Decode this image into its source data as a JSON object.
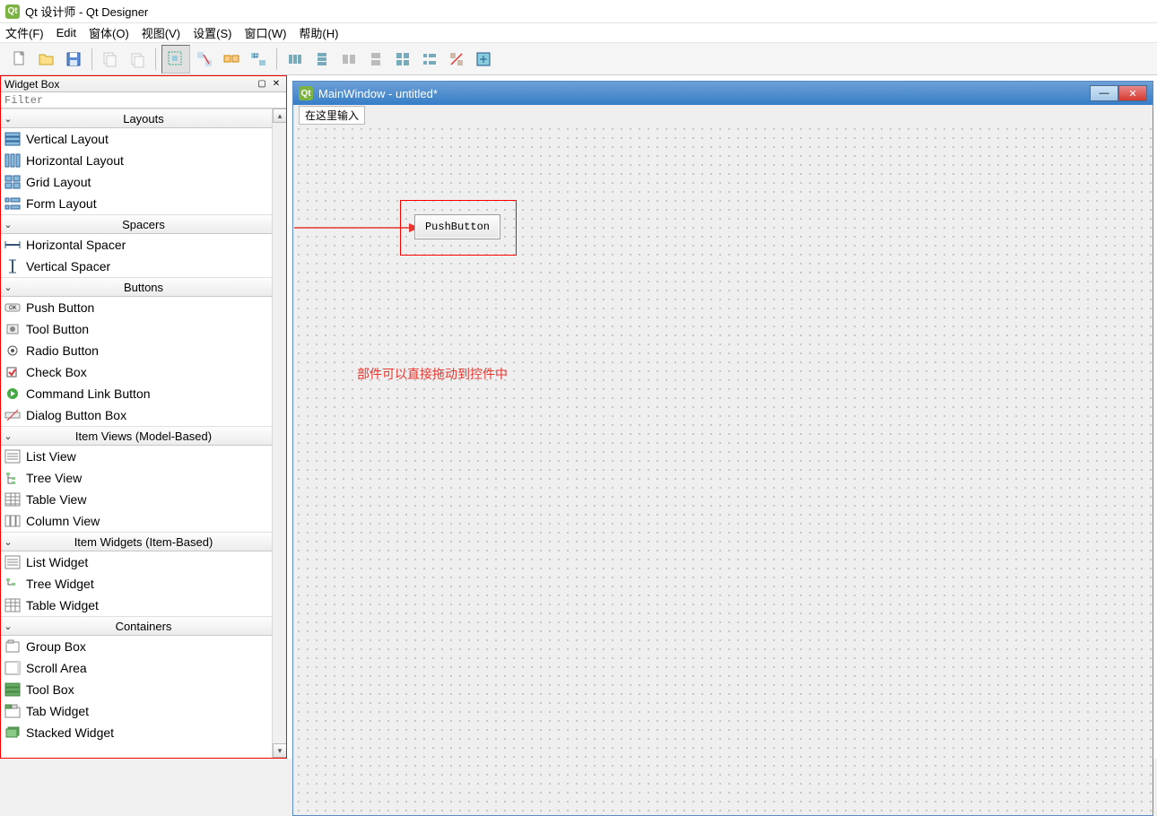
{
  "window": {
    "title": "Qt 设计师 - Qt Designer"
  },
  "menu": {
    "file": "文件(F)",
    "edit": "Edit",
    "form": "窗体(O)",
    "view": "视图(V)",
    "settings": "设置(S)",
    "window": "窗口(W)",
    "help": "帮助(H)"
  },
  "toolbar": {
    "newIcon": "new",
    "openIcon": "open",
    "saveIcon": "save"
  },
  "widgetBox": {
    "title": "Widget Box",
    "filter_placeholder": "Filter",
    "categories": {
      "layouts": {
        "label": "Layouts",
        "items": [
          "Vertical Layout",
          "Horizontal Layout",
          "Grid Layout",
          "Form Layout"
        ]
      },
      "spacers": {
        "label": "Spacers",
        "items": [
          "Horizontal Spacer",
          "Vertical Spacer"
        ]
      },
      "buttons": {
        "label": "Buttons",
        "items": [
          "Push Button",
          "Tool Button",
          "Radio Button",
          "Check Box",
          "Command Link Button",
          "Dialog Button Box"
        ]
      },
      "itemviews": {
        "label": "Item Views (Model-Based)",
        "items": [
          "List View",
          "Tree View",
          "Table View",
          "Column View"
        ]
      },
      "itemwidgets": {
        "label": "Item Widgets (Item-Based)",
        "items": [
          "List Widget",
          "Tree Widget",
          "Table Widget"
        ]
      },
      "containers": {
        "label": "Containers",
        "items": [
          "Group Box",
          "Scroll Area",
          "Tool Box",
          "Tab Widget",
          "Stacked Widget"
        ]
      }
    }
  },
  "design": {
    "windowTitle": "MainWindow - untitled*",
    "inputHint": "在这里输入",
    "pushButtonLabel": "PushButton"
  },
  "annotation": "部件可以直接拖动到控件中",
  "watermark": ""
}
